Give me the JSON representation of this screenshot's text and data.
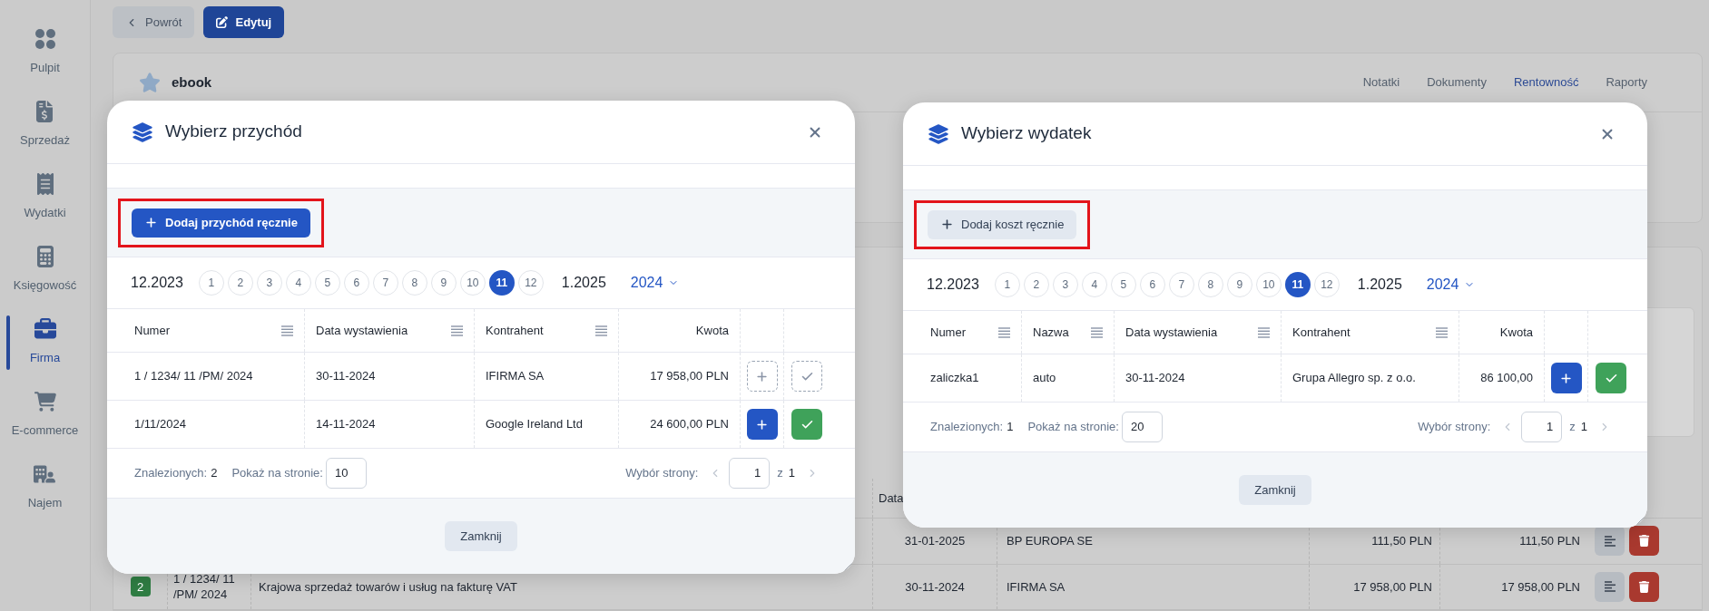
{
  "sidebar": {
    "items": [
      {
        "label": "Pulpit",
        "selected": false
      },
      {
        "label": "Sprzedaż",
        "selected": false
      },
      {
        "label": "Wydatki",
        "selected": false
      },
      {
        "label": "Księgowość",
        "selected": false
      },
      {
        "label": "Firma",
        "selected": true
      },
      {
        "label": "E-commerce",
        "selected": false
      },
      {
        "label": "Najem",
        "selected": false
      }
    ]
  },
  "top_buttons": [
    {
      "label": "Powrót",
      "kind": "back"
    },
    {
      "label": "Edytuj",
      "kind": "edit"
    }
  ],
  "project": {
    "title": "ebook",
    "tabs": [
      {
        "label": "Notatki",
        "selected": false
      },
      {
        "label": "Dokumenty",
        "selected": false
      },
      {
        "label": "Rentowność",
        "selected": true
      },
      {
        "label": "Raporty",
        "selected": false
      }
    ]
  },
  "background_table": {
    "date_column_label": "Data",
    "rows": [
      {
        "date": "31-01-2025",
        "contractor": "BP EUROPA SE",
        "net": "111,50 PLN",
        "gross": "111,50 PLN"
      },
      {
        "badge": "2",
        "color": "#2f7d43",
        "number": "1 / 1234/ 11 /PM/ 2024",
        "description": "Krajowa sprzedaż towarów i usług na fakturę VAT",
        "date": "30-11-2024",
        "contractor": "IFIRMA SA",
        "net": "17 958,00 PLN",
        "gross": "17 958,00 PLN"
      }
    ]
  },
  "modals": [
    {
      "title": "Wybierz przychód",
      "add_button": {
        "label": "Dodaj przychód ręcznie",
        "kind": "primary",
        "highlighted": true
      },
      "period": {
        "start": "12.2023",
        "months": [
          {
            "label": "1",
            "selected": false
          },
          {
            "label": "2",
            "selected": false
          },
          {
            "label": "3",
            "selected": false
          },
          {
            "label": "4",
            "selected": false
          },
          {
            "label": "5",
            "selected": false
          },
          {
            "label": "6",
            "selected": false
          },
          {
            "label": "7",
            "selected": false
          },
          {
            "label": "8",
            "selected": false
          },
          {
            "label": "9",
            "selected": false
          },
          {
            "label": "10",
            "selected": false
          },
          {
            "label": "11",
            "selected": true
          },
          {
            "label": "12",
            "selected": false
          }
        ],
        "end": "1.2025",
        "year": "2024"
      },
      "table": {
        "columns": [
          {
            "label": "Numer",
            "menu": true
          },
          {
            "label": "Data wystawienia",
            "menu": true
          },
          {
            "label": "Kontrahent",
            "menu": true
          },
          {
            "label": "Kwota",
            "menu": false
          }
        ],
        "rows": [
          {
            "cells": [
              "1 / 1234/ 11 /PM/ 2024",
              "30-11-2024",
              "IFIRMA SA",
              "17 958,00 PLN"
            ],
            "disabled": true
          },
          {
            "cells": [
              "1/11/2024",
              "14-11-2024",
              "Google Ireland Ltd",
              "24 600,00 PLN"
            ],
            "disabled": false
          }
        ]
      },
      "footer": {
        "found_label": "Znalezionych:",
        "found": "2",
        "per_page_label": "Pokaż na stronie:",
        "per_page": "10",
        "page_label": "Wybór strony:",
        "page": "1",
        "of": "z",
        "pages": "1"
      },
      "close_button": "Zamknij"
    },
    {
      "title": "Wybierz wydatek",
      "add_button": {
        "label": "Dodaj koszt ręcznie",
        "kind": "secondary",
        "highlighted": true
      },
      "period": {
        "start": "12.2023",
        "months": [
          {
            "label": "1",
            "selected": false
          },
          {
            "label": "2",
            "selected": false
          },
          {
            "label": "3",
            "selected": false
          },
          {
            "label": "4",
            "selected": false
          },
          {
            "label": "5",
            "selected": false
          },
          {
            "label": "6",
            "selected": false
          },
          {
            "label": "7",
            "selected": false
          },
          {
            "label": "8",
            "selected": false
          },
          {
            "label": "9",
            "selected": false
          },
          {
            "label": "10",
            "selected": false
          },
          {
            "label": "11",
            "selected": true
          },
          {
            "label": "12",
            "selected": false
          }
        ],
        "end": "1.2025",
        "year": "2024"
      },
      "table": {
        "columns": [
          {
            "label": "Numer",
            "menu": true
          },
          {
            "label": "Nazwa",
            "menu": true
          },
          {
            "label": "Data wystawienia",
            "menu": true
          },
          {
            "label": "Kontrahent",
            "menu": true
          },
          {
            "label": "Kwota",
            "menu": false
          }
        ],
        "rows": [
          {
            "cells": [
              "zaliczka1",
              "auto",
              "30-11-2024",
              "Grupa Allegro sp. z o.o.",
              "86 100,00"
            ],
            "disabled": false
          }
        ]
      },
      "footer": {
        "found_label": "Znalezionych:",
        "found": "1",
        "per_page_label": "Pokaż na stronie:",
        "per_page": "20",
        "page_label": "Wybór strony:",
        "page": "1",
        "of": "z",
        "pages": "1"
      },
      "close_button": "Zamknij"
    }
  ]
}
